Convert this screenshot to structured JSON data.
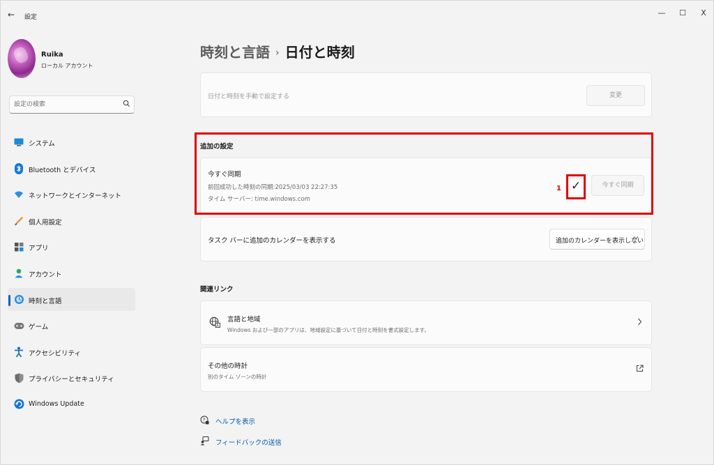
{
  "window": {
    "title": "設定",
    "back_glyph": "←",
    "minimize_glyph": "—",
    "maximize_glyph": "☐",
    "close_glyph": "X"
  },
  "profile": {
    "name": "Ruika",
    "account_type": "ローカル アカウント"
  },
  "search": {
    "placeholder": "設定の検索",
    "icon": "search-icon"
  },
  "sidebar": {
    "items": [
      {
        "label": "システム",
        "icon": "system-icon",
        "active": false
      },
      {
        "label": "Bluetooth とデバイス",
        "icon": "bluetooth-icon",
        "active": false
      },
      {
        "label": "ネットワークとインターネット",
        "icon": "network-icon",
        "active": false
      },
      {
        "label": "個人用設定",
        "icon": "personalization-icon",
        "active": false
      },
      {
        "label": "アプリ",
        "icon": "apps-icon",
        "active": false
      },
      {
        "label": "アカウント",
        "icon": "account-icon",
        "active": false
      },
      {
        "label": "時刻と言語",
        "icon": "time-language-icon",
        "active": true
      },
      {
        "label": "ゲーム",
        "icon": "gaming-icon",
        "active": false
      },
      {
        "label": "アクセシビリティ",
        "icon": "accessibility-icon",
        "active": false
      },
      {
        "label": "プライバシーとセキュリティ",
        "icon": "privacy-security-icon",
        "active": false
      },
      {
        "label": "Windows Update",
        "icon": "windows-update-icon",
        "active": false
      }
    ]
  },
  "breadcrumb": {
    "parent": "時刻と言語",
    "separator": "›",
    "current": "日付と時刻"
  },
  "manual_time": {
    "label": "日付と時刻を手動で設定する",
    "button": "変更"
  },
  "additional": {
    "section_title": "追加の設定",
    "sync_title": "今すぐ同期",
    "last_sync": "前回成功した時刻の同期:2025/03/03 22:27:35",
    "time_server": "タイム サーバー: time.windows.com",
    "sync_button": "今すぐ同期",
    "check_glyph": "✓",
    "annotation_number": "1"
  },
  "calendar": {
    "label": "タスク バーに追加のカレンダーを表示する",
    "dropdown_value": "追加のカレンダーを表示しない"
  },
  "related": {
    "section_title": "関連リンク",
    "links": [
      {
        "title": "言語と地域",
        "subtitle": "Windows および一部のアプリは、地域設定に基づいて日付と時刻を書式設定します。"
      },
      {
        "title": "その他の時計",
        "subtitle": "別のタイム ゾーンの時計"
      }
    ]
  },
  "footer": {
    "help": "ヘルプを表示",
    "feedback": "フィードバックの送信"
  },
  "colors": {
    "accent": "#0067c0",
    "annotation_red": "#e00000",
    "background": "#f3f3f3",
    "card": "#fbfbfb"
  }
}
